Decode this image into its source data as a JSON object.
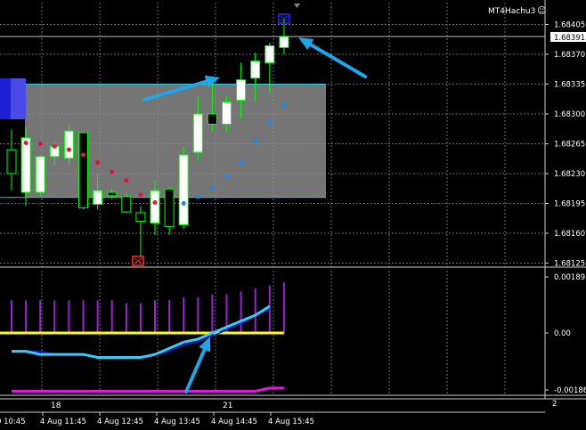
{
  "app": {
    "label": "MT4Hachu3",
    "smiley": "☺"
  },
  "colors": {
    "background": "#000000",
    "grid": "#6b6b6b",
    "axis_text": "#ffffff",
    "bull_candle": "#ffffff",
    "bear_candle": "#000000",
    "candle_outline": "#00ff00",
    "zone_fill": "#8a8a8a",
    "zone_border": "#35c8d8",
    "zone_left": "#1f1fd6",
    "dot_red": "#e8123c",
    "dot_blue": "#1f86e8",
    "arrow": "#1fa6e8",
    "buy_marker": "#2b2bff",
    "sell_marker": "#ff2b2b",
    "hist": "#9b1fd6",
    "line_cyan": "#33ccff",
    "line_blue": "#1a1ad6",
    "line_yellow": "#ffff00",
    "line_magenta": "#e21ae2",
    "price_marker_bg": "#ffffff",
    "price_marker_text": "#000000"
  },
  "chart_data": [
    {
      "type": "candlestick",
      "title": "",
      "y_ticks": [
        "1.68405",
        "1.68370",
        "1.68335",
        "1.68300",
        "1.68265",
        "1.68230",
        "1.68195",
        "1.68160",
        "1.68125"
      ],
      "ylim": [
        1.6812,
        1.6843
      ],
      "current_price": "1.68391",
      "candles": [
        {
          "o": 1.68258,
          "h": 1.68282,
          "l": 1.6821,
          "c": 1.6823
        },
        {
          "o": 1.68208,
          "h": 1.68285,
          "l": 1.68192,
          "c": 1.68272
        },
        {
          "o": 1.68208,
          "h": 1.68252,
          "l": 1.68204,
          "c": 1.6825
        },
        {
          "o": 1.6825,
          "h": 1.68268,
          "l": 1.6824,
          "c": 1.68262
        },
        {
          "o": 1.68248,
          "h": 1.68288,
          "l": 1.6824,
          "c": 1.6828
        },
        {
          "o": 1.68278,
          "h": 1.6828,
          "l": 1.68188,
          "c": 1.6819
        },
        {
          "o": 1.68194,
          "h": 1.6823,
          "l": 1.68188,
          "c": 1.6821
        },
        {
          "o": 1.68208,
          "h": 1.68212,
          "l": 1.682,
          "c": 1.68204
        },
        {
          "o": 1.68203,
          "h": 1.68208,
          "l": 1.68184,
          "c": 1.68185
        },
        {
          "o": 1.68184,
          "h": 1.68192,
          "l": 1.68132,
          "c": 1.68174
        },
        {
          "o": 1.68172,
          "h": 1.68222,
          "l": 1.68158,
          "c": 1.6821
        },
        {
          "o": 1.68212,
          "h": 1.68215,
          "l": 1.68158,
          "c": 1.68168
        },
        {
          "o": 1.6817,
          "h": 1.68262,
          "l": 1.68165,
          "c": 1.68252
        },
        {
          "o": 1.68255,
          "h": 1.6832,
          "l": 1.68245,
          "c": 1.683
        },
        {
          "o": 1.683,
          "h": 1.6834,
          "l": 1.6828,
          "c": 1.68288
        },
        {
          "o": 1.68288,
          "h": 1.68322,
          "l": 1.6828,
          "c": 1.68314
        },
        {
          "o": 1.68316,
          "h": 1.6836,
          "l": 1.68295,
          "c": 1.6834
        },
        {
          "o": 1.68342,
          "h": 1.68372,
          "l": 1.68315,
          "c": 1.68362
        },
        {
          "o": 1.6836,
          "h": 1.68384,
          "l": 1.68325,
          "c": 1.6838
        },
        {
          "o": 1.68378,
          "h": 1.68412,
          "l": 1.6837,
          "c": 1.68391
        }
      ],
      "zone": {
        "top": 1.68335,
        "bottom": 1.68202
      },
      "red_dots": [
        1.68266,
        1.68265,
        1.68262,
        1.68258,
        1.68252,
        1.68243,
        1.68232,
        1.68222,
        1.68205,
        1.68196
      ],
      "blue_dots": [
        1.68195,
        1.68203,
        1.68213,
        1.68227,
        1.68243,
        1.68268,
        1.68291,
        1.6831
      ]
    },
    {
      "type": "indicator",
      "title": "",
      "y_ticks": [
        "0.00189",
        "0.00",
        "-0.00186"
      ],
      "ylim": [
        -0.0021,
        0.0021
      ],
      "histogram": [
        0.0011,
        0.0011,
        0.0011,
        0.0011,
        0.0011,
        0.0011,
        0.0011,
        0.0011,
        0.001,
        0.001,
        0.0011,
        0.0011,
        0.0012,
        0.0012,
        0.0013,
        0.0013,
        0.0014,
        0.0015,
        0.0016,
        0.0017
      ],
      "line_cyan": [
        -0.0006,
        -0.0006,
        -0.0007,
        -0.0007,
        -0.0007,
        -0.0007,
        -0.0008,
        -0.0008,
        -0.0008,
        -0.0008,
        -0.0007,
        -0.0005,
        -0.0003,
        -0.0002,
        0.0,
        0.0002,
        0.0004,
        0.0006,
        0.0009
      ],
      "line_blue": [
        -0.0006,
        -0.0006,
        -0.0006,
        -0.0007,
        -0.0007,
        -0.0007,
        -0.0008,
        -0.0008,
        -0.0008,
        -0.0008,
        -0.0007,
        -0.0006,
        -0.0004,
        -0.0003,
        -0.0001,
        0.0001,
        0.0003,
        0.0006,
        0.0008
      ],
      "line_yellow": 0,
      "line_magenta": [
        -0.0019,
        -0.0019,
        -0.0019,
        -0.0019,
        -0.0019,
        -0.0019,
        -0.0019,
        -0.0019,
        -0.0019,
        -0.0019,
        -0.0019,
        -0.0019,
        -0.0019,
        -0.0019,
        -0.0019,
        -0.0019,
        -0.0019,
        -0.0019,
        -0.0018,
        -0.0018
      ]
    }
  ],
  "panel3": {
    "label": "2"
  },
  "x_axis": {
    "day_labels": [
      "18",
      "21"
    ],
    "time_labels": [
      "0 10:45",
      "4 Aug 11:45",
      "4 Aug 12:45",
      "4 Aug 13:45",
      "4 Aug 14:45",
      "4 Aug 15:45"
    ]
  },
  "arrows": {
    "count": 3
  }
}
